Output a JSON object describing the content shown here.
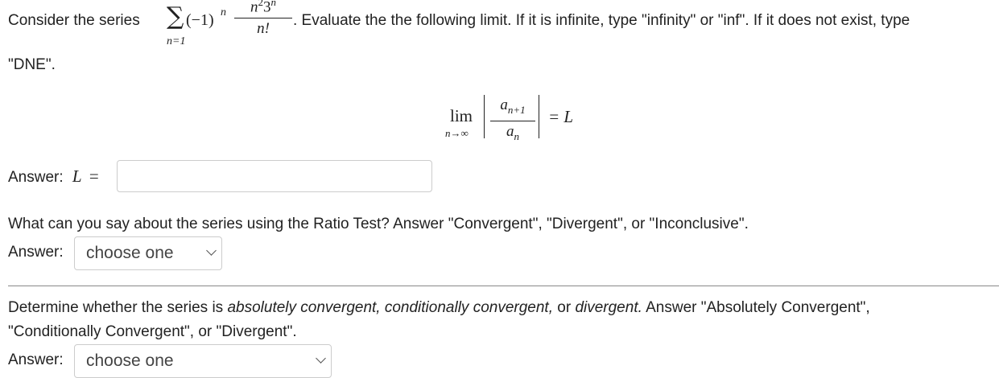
{
  "q1": {
    "prefix": "Consider the series",
    "sum_upper": "∞",
    "sum_lower": "n=1",
    "term_base": "(−1)",
    "term_exp": "n",
    "num": "n",
    "num_exp1": "2",
    "num_base2": "3",
    "num_exp2": "n",
    "den": "n!",
    "suffix": ". Evaluate the the following limit. If it is infinite, type \"infinity\" or \"inf\". If it does not exist, type",
    "line2": "\"DNE\".",
    "lim": "lim",
    "lim_sub": "n→∞",
    "ratio_num": "a",
    "ratio_num_sub": "n+1",
    "ratio_den": "a",
    "ratio_den_sub": "n",
    "equals": "= L",
    "answer_label": "Answer:",
    "answer_var": "L",
    "answer_eq": "=",
    "answer_value": ""
  },
  "q2": {
    "text": "What can you say about the series using the Ratio Test? Answer \"Convergent\", \"Divergent\", or \"Inconclusive\".",
    "answer_label": "Answer:",
    "select_value": "choose one"
  },
  "q3": {
    "text_a": "Determine whether the series is ",
    "em1": "absolutely convergent, conditionally convergent,",
    "text_b": " or ",
    "em2": "divergent.",
    "text_c": " Answer \"Absolutely Convergent\",",
    "line2": "\"Conditionally Convergent\", or \"Divergent\".",
    "answer_label": "Answer:",
    "select_value": "choose one"
  }
}
